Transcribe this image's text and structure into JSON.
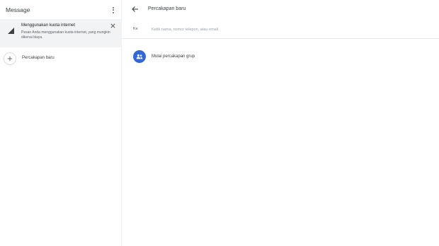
{
  "left": {
    "app_title": "Message",
    "banner": {
      "title": "Menggunakan kuota internet",
      "description": "Pesan Anda menggunakan kuota internet, yang mungkin dikenai biaya.",
      "icon": "signal-icon"
    },
    "new_conversation_label": "Percakapan baru"
  },
  "right": {
    "title": "Percakapan baru",
    "recipient": {
      "label": "Ke",
      "placeholder": "Ketik nama, nomor telepon, atau email"
    },
    "group_label": "Mulai percakapan grup"
  },
  "colors": {
    "accent": "#3367d6",
    "banner_bg": "#f1f3f4"
  }
}
